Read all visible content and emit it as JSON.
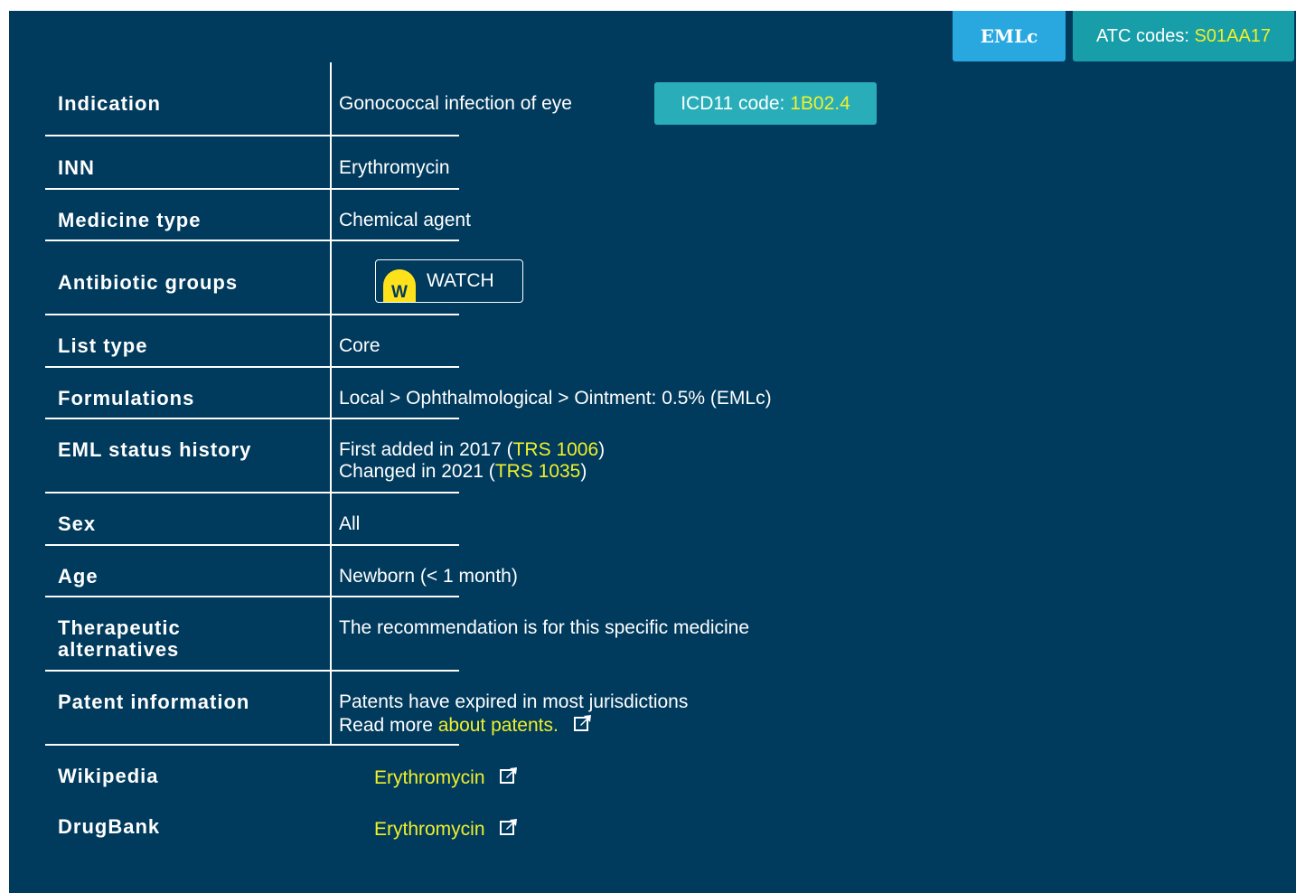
{
  "header": {
    "emlc_badge": "EMLc",
    "atc_label": "ATC codes: ",
    "atc_code": "S01AA17"
  },
  "rows": {
    "indication": {
      "label": "Indication",
      "value": "Gonococcal infection of eye",
      "icd_label": "ICD11 code: ",
      "icd_code": "1B02.4"
    },
    "inn": {
      "label": "INN",
      "value": "Erythromycin"
    },
    "medicine_type": {
      "label": "Medicine type",
      "value": "Chemical agent"
    },
    "antibiotic_groups": {
      "label": "Antibiotic groups",
      "icon_letter": "W",
      "value": "WATCH"
    },
    "list_type": {
      "label": "List type",
      "value": "Core"
    },
    "formulations": {
      "label": "Formulations",
      "value": "Local > Ophthalmological > Ointment: 0.5% (EMLc)"
    },
    "eml_status_history": {
      "label": "EML status history",
      "line1_prefix": "First added in 2017 (",
      "line1_link": "TRS 1006",
      "line1_suffix": ")",
      "line2_prefix": "Changed in 2021 (",
      "line2_link": "TRS 1035",
      "line2_suffix": ")"
    },
    "sex": {
      "label": "Sex",
      "value": "All"
    },
    "age": {
      "label": "Age",
      "value": "Newborn (< 1 month)"
    },
    "therapeutic_alternatives": {
      "label_line1": "Therapeutic",
      "label_line2": "alternatives",
      "value": "The recommendation is for this specific medicine"
    },
    "patent_information": {
      "label": "Patent information",
      "line1": "Patents have expired in most jurisdictions",
      "line2_prefix": "Read more ",
      "line2_link": "about patents."
    },
    "wikipedia": {
      "label": "Wikipedia",
      "link": "Erythromycin"
    },
    "drugbank": {
      "label": "DrugBank",
      "link": "Erythromycin"
    }
  },
  "colors": {
    "panel_bg": "#003a5d",
    "link": "#f0f02a",
    "emlc_badge": "#29a8e0",
    "atc_badge": "#179ea8",
    "icd_badge": "#29aeb9",
    "watch_icon": "#fce11b"
  },
  "icons": {
    "external_link": "external-link-icon",
    "watch": "watch-icon"
  }
}
